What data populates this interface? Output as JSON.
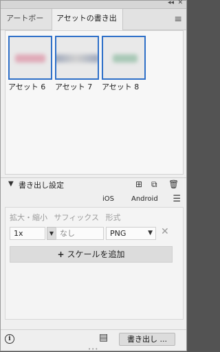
{
  "titlebar": {
    "collapse_glyph": "◂◂",
    "close_glyph": "✕"
  },
  "tabs": [
    {
      "label": "アートボード",
      "active": false
    },
    {
      "label": "アセットの書き出し",
      "active": true
    }
  ],
  "panel_menu_icon": "hamburger-icon",
  "assets": [
    {
      "label": "アセット 6",
      "thumb_color": "#e0aab8"
    },
    {
      "label": "アセット 7",
      "thumb_color": "#9ea8bc"
    },
    {
      "label": "アセット 8",
      "thumb_color": "#a8c8b6"
    }
  ],
  "export_settings": {
    "title": "書き出し設定",
    "icons": [
      "add-square-icon",
      "duplicate-icon",
      "trash-icon"
    ]
  },
  "platforms": {
    "ios": "iOS",
    "android": "Android"
  },
  "columns": {
    "scale": "拡大・縮小",
    "suffix": "サフィックス",
    "format": "形式"
  },
  "row": {
    "scale": "1x",
    "suffix_placeholder": "なし",
    "format": "PNG"
  },
  "add_scale_label": "スケールを追加",
  "bottom": {
    "export_label": "書き出し ..."
  },
  "accent": "#2d6fc8"
}
